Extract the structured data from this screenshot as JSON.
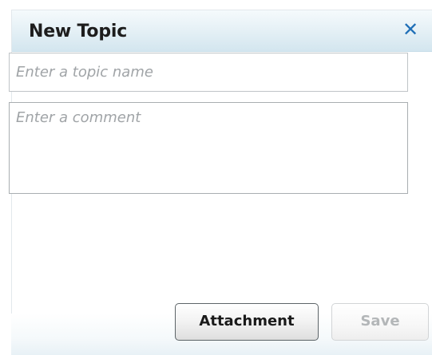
{
  "dialog": {
    "title": "New Topic",
    "close_icon": "close-icon",
    "close_glyph": "✕",
    "accent_color": "#1f6fb7"
  },
  "form": {
    "topic_placeholder": "Enter a topic name",
    "topic_value": "",
    "comment_placeholder": "Enter a comment",
    "comment_value": ""
  },
  "buttons": {
    "attachment_label": "Attachment",
    "save_label": "Save",
    "save_disabled": true
  }
}
